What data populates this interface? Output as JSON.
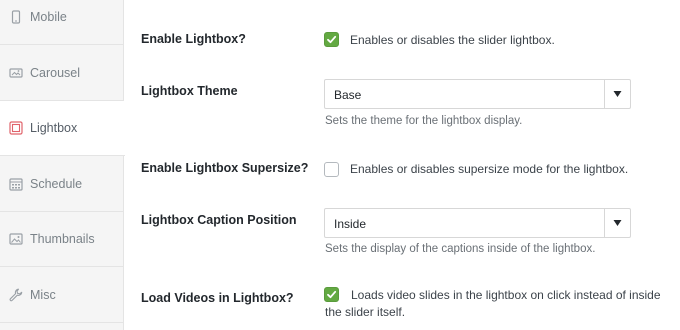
{
  "sidebar": {
    "items": [
      {
        "label": "Mobile",
        "icon": "mobile-icon"
      },
      {
        "label": "Carousel",
        "icon": "carousel-icon"
      },
      {
        "label": "Lightbox",
        "icon": "lightbox-icon",
        "active": true
      },
      {
        "label": "Schedule",
        "icon": "calendar-icon"
      },
      {
        "label": "Thumbnails",
        "icon": "image-icon"
      },
      {
        "label": "Misc",
        "icon": "wrench-icon"
      }
    ]
  },
  "settings": {
    "enable_lightbox": {
      "label": "Enable Lightbox?",
      "checked": true,
      "description": "Enables or disables the slider lightbox."
    },
    "lightbox_theme": {
      "label": "Lightbox Theme",
      "value": "Base",
      "help": "Sets the theme for the lightbox display."
    },
    "enable_supersize": {
      "label": "Enable Lightbox Supersize?",
      "checked": false,
      "description": "Enables or disables supersize mode for the lightbox."
    },
    "caption_position": {
      "label": "Lightbox Caption Position",
      "value": "Inside",
      "help": "Sets the display of the captions inside of the lightbox."
    },
    "load_videos": {
      "label": "Load Videos in Lightbox?",
      "checked": true,
      "description_line1": "Loads video slides in the lightbox on click instead of inside",
      "description_line2": "the slider itself."
    }
  },
  "colors": {
    "checkbox_checked": "#63a942",
    "active_icon": "#e0636b",
    "sidebar_bg": "#f5f5f5"
  }
}
